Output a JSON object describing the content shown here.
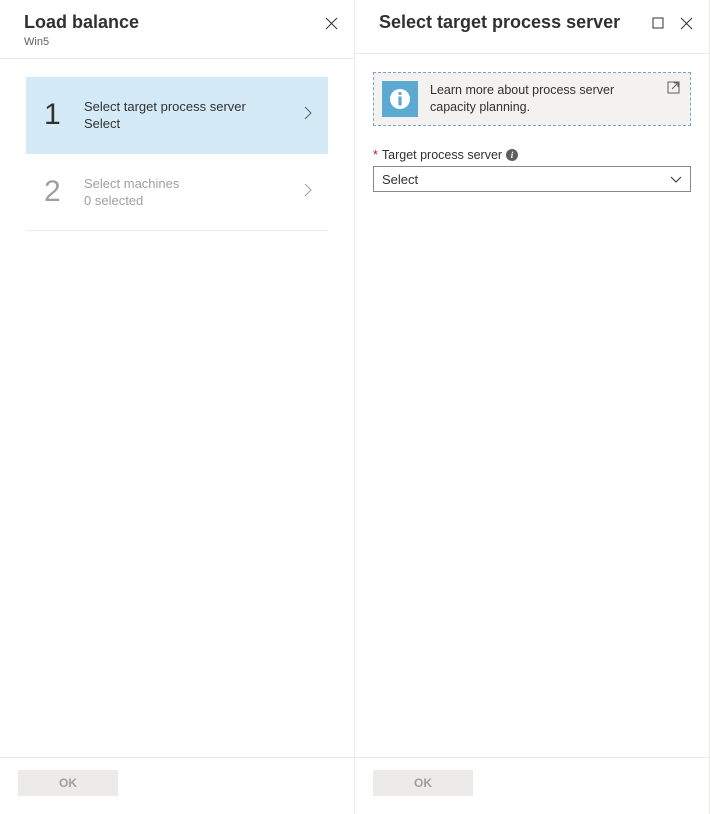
{
  "left": {
    "title": "Load balance",
    "subtitle": "Win5",
    "steps": [
      {
        "num": "1",
        "title": "Select target process server",
        "sub": "Select"
      },
      {
        "num": "2",
        "title": "Select machines",
        "sub": "0 selected"
      }
    ],
    "ok": "OK"
  },
  "right": {
    "title": "Select target process server",
    "info": "Learn more about process server capacity planning.",
    "field_label": "Target process server",
    "select_value": "Select",
    "ok": "OK"
  }
}
